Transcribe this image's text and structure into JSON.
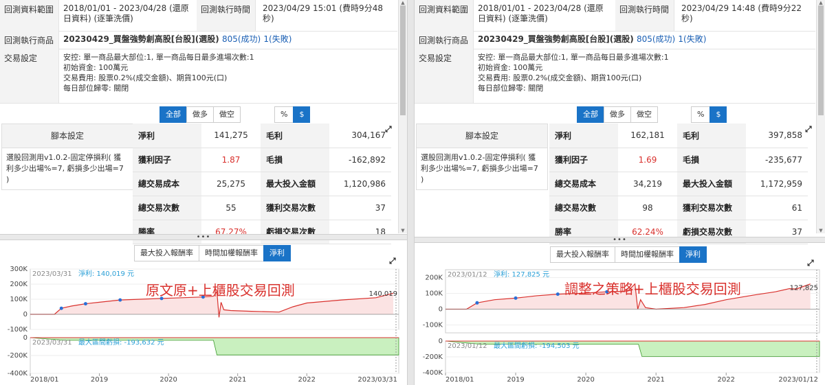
{
  "labels": {
    "range": "回測資料範圍",
    "exec_time": "回測執行時間",
    "product": "回測執行商品",
    "trade_setting": "交易設定",
    "script_setting": "腳本設定",
    "bt_all": "全部",
    "bt_long": "做多",
    "bt_short": "做空",
    "bt_pct": "%",
    "bt_dollar": "$",
    "tab_max": "最大投入報酬率",
    "tab_time": "時間加權報酬率",
    "tab_net": "淨利",
    "net": "淨利",
    "gross": "毛利",
    "pf": "獲利因子",
    "gross_loss": "毛損",
    "cost": "總交易成本",
    "max_invest": "最大投入金額",
    "trades": "總交易次數",
    "win_trades": "獲利交易次數",
    "winrate": "勝率",
    "loss_trades": "虧損交易次數",
    "dd_label": "最大區間虧損:",
    "net_label": "淨利:",
    "currency": "元",
    "ok": "(成功)",
    "fail": "(失敗)"
  },
  "panels": [
    {
      "range": "2018/01/01 - 2023/04/28 (還原日資料) (逐筆洗價)",
      "exec_time": "2023/04/29 15:01 (費時9分48秒)",
      "product_name": "20230429_買盤強勢創高股[台股](選股)",
      "ok_count": "805",
      "fail_count": "1",
      "trade_lines": [
        "安控: 單一商品最大部位:1, 單一商品每日最多進場次數:1",
        "初始資金: 100萬元",
        "交易費用: 股票0.2%(成交金額)、期貨100元(口)",
        "每日部位歸零: 關閉"
      ],
      "script_text": "選股回測用v1.0.2-固定停損利( 獲利多少出場%=7, 虧損多少出場=7 )",
      "stats": {
        "net": "141,275",
        "gross": "304,167",
        "pf": "1.87",
        "gross_loss": "-162,892",
        "cost": "25,275",
        "max_invest": "1,120,986",
        "trades": "55",
        "win_trades": "37",
        "winrate": "67.27%",
        "loss_trades": "18"
      },
      "chart_title": "原文原+上櫃股交易回測",
      "cursor_date": "2023/03/31",
      "cursor_net": "140,019",
      "cursor_dd": "-193,632",
      "end_value_label": "140,019",
      "end_date_label": "2023/03/31"
    },
    {
      "range": "2018/01/01 - 2023/04/28 (還原日資料) (逐筆洗價)",
      "exec_time": "2023/04/29 14:48 (費時9分22秒)",
      "product_name": "20230429_買盤強勢創高股[台股](選股)",
      "ok_count": "805",
      "fail_count": "1",
      "trade_lines": [
        "安控: 單一商品最大部位:1, 單一商品每日最多進場次數:1",
        "初始資金: 100萬元",
        "交易費用: 股票0.2%(成交金額)、期貨100元(口)",
        "每日部位歸零: 關閉"
      ],
      "script_text": "選股回測用v1.0.2-固定停損利( 獲利多少出場%=7, 虧損多少出場=7 )",
      "stats": {
        "net": "162,181",
        "gross": "397,858",
        "pf": "1.69",
        "gross_loss": "-235,677",
        "cost": "34,219",
        "max_invest": "1,172,959",
        "trades": "98",
        "win_trades": "61",
        "winrate": "62.24%",
        "loss_trades": "37"
      },
      "chart_title": "調整之策略+上櫃股交易回測",
      "cursor_date": "2023/01/12",
      "cursor_net": "127,825",
      "cursor_dd": "-194,503",
      "end_value_label": "127,825",
      "end_date_label": "2023/01/12"
    }
  ],
  "chart_data": [
    {
      "type": "area",
      "title": "原文原+上櫃股交易回測",
      "x_ticks": [
        "2018/01",
        "2019",
        "2020",
        "2021",
        "2022"
      ],
      "y_top_ticks": [
        "300K",
        "200K",
        "100K",
        "0",
        "-100K"
      ],
      "y_top_range": [
        -100000,
        300000
      ],
      "y_bottom_ticks": [
        "0",
        "-200K",
        "-400K"
      ],
      "y_bottom_range": [
        -400000,
        0
      ],
      "x_range": [
        2018.0,
        2023.33
      ],
      "net_series": {
        "name": "淨利",
        "x": [
          2018.0,
          2018.35,
          2018.45,
          2018.6,
          2018.8,
          2019.0,
          2019.3,
          2019.6,
          2019.9,
          2020.2,
          2020.5,
          2020.65,
          2020.7,
          2020.73,
          2020.76,
          2020.8,
          2020.9,
          2021.2,
          2021.6,
          2021.8,
          2022.0,
          2022.5,
          2023.0,
          2023.25
        ],
        "y": [
          0,
          0,
          40000,
          55000,
          70000,
          80000,
          95000,
          100000,
          105000,
          110000,
          115000,
          120000,
          150000,
          -20000,
          80000,
          30000,
          25000,
          20000,
          15000,
          50000,
          75000,
          95000,
          110000,
          140019
        ]
      },
      "drawdown_series": {
        "name": "最大區間虧損",
        "x": [
          2018.0,
          2018.5,
          2020.65,
          2020.7,
          2023.33
        ],
        "y": [
          0,
          -30000,
          -30000,
          -193632,
          -193632
        ]
      }
    },
    {
      "type": "area",
      "title": "調整之策略+上櫃股交易回測",
      "x_ticks": [
        "2018/01",
        "2019",
        "2020",
        "2021",
        "2022"
      ],
      "y_top_ticks": [
        "200K",
        "100K",
        "0",
        "-100K"
      ],
      "y_top_range": [
        -150000,
        250000
      ],
      "y_bottom_ticks": [
        "0",
        "-200K",
        "-400K"
      ],
      "y_bottom_range": [
        -400000,
        0
      ],
      "x_range": [
        2018.0,
        2023.33
      ],
      "net_series": {
        "name": "淨利",
        "x": [
          2018.0,
          2018.3,
          2018.45,
          2018.7,
          2019.0,
          2019.3,
          2019.6,
          2019.9,
          2020.3,
          2020.6,
          2020.7,
          2020.74,
          2020.78,
          2020.85,
          2021.0,
          2021.4,
          2021.7,
          2022.0,
          2022.4,
          2022.7,
          2022.9,
          2023.0,
          2023.2
        ],
        "y": [
          0,
          0,
          40000,
          60000,
          70000,
          85000,
          95000,
          100000,
          110000,
          115000,
          160000,
          0,
          60000,
          10000,
          0,
          10000,
          30000,
          60000,
          90000,
          110000,
          130000,
          127825,
          160000
        ]
      },
      "drawdown_series": {
        "name": "最大區間虧損",
        "x": [
          2018.0,
          2018.5,
          2020.75,
          2020.8,
          2023.33
        ],
        "y": [
          0,
          -40000,
          -40000,
          -194503,
          -194503
        ]
      }
    }
  ]
}
